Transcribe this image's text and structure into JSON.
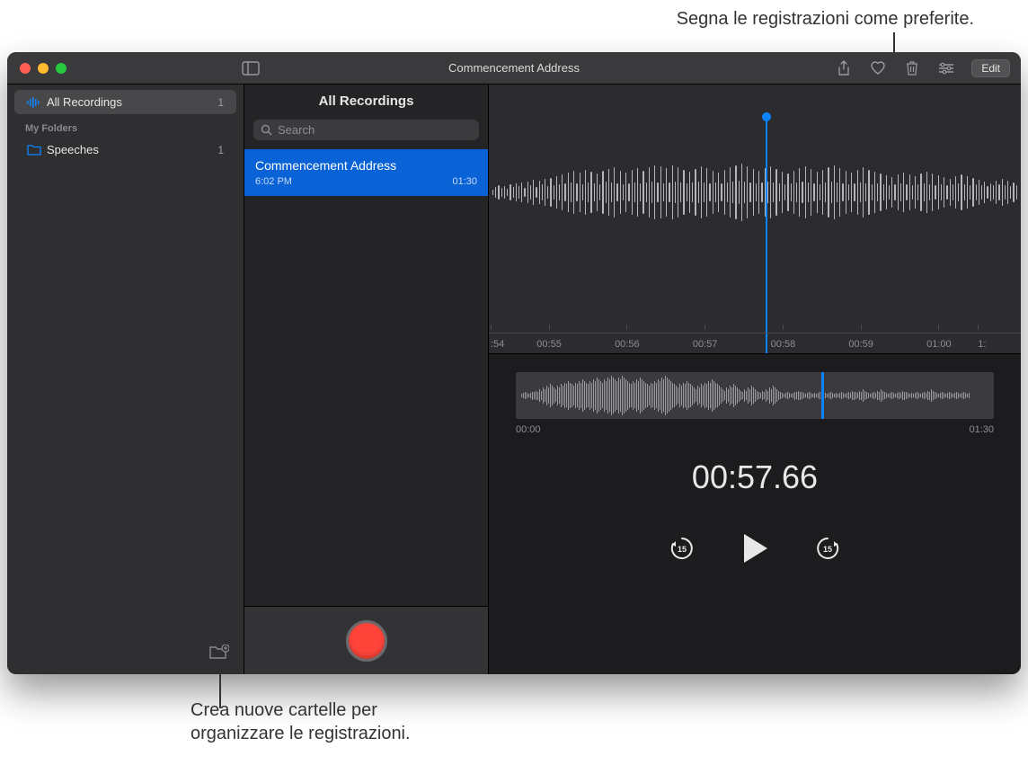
{
  "annotations": {
    "top": "Segna le registrazioni come preferite.",
    "bottom_line1": "Crea nuove cartelle per",
    "bottom_line2": "organizzare le registrazioni."
  },
  "window": {
    "title": "Commencement Address"
  },
  "toolbar": {
    "edit_label": "Edit"
  },
  "sidebar": {
    "all_recordings": {
      "label": "All Recordings",
      "count": "1"
    },
    "section_label": "My Folders",
    "folders": [
      {
        "label": "Speeches",
        "count": "1"
      }
    ]
  },
  "list": {
    "header": "All Recordings",
    "search_placeholder": "Search",
    "items": [
      {
        "name": "Commencement Address",
        "time": "6:02 PM",
        "duration": "01:30"
      }
    ]
  },
  "timeline": {
    "ticks": [
      ":54",
      "00:55",
      "00:56",
      "00:57",
      "00:58",
      "00:59",
      "01:00",
      "1:"
    ]
  },
  "overview": {
    "start": "00:00",
    "end": "01:30"
  },
  "playback": {
    "current_time": "00:57.66"
  },
  "icons": {
    "waveform_bars": [
      6,
      12,
      16,
      10,
      14,
      8,
      18,
      12,
      20,
      14,
      22,
      10,
      24,
      16,
      28,
      12,
      26,
      18,
      30,
      14,
      32,
      16,
      36,
      18,
      40,
      20,
      44,
      22,
      48,
      20,
      44,
      18,
      50,
      22,
      46,
      20,
      42,
      18,
      48,
      24,
      52,
      22,
      56,
      20,
      48,
      18,
      44,
      20,
      50,
      22,
      54,
      20,
      48,
      22,
      56,
      24,
      60,
      22,
      58,
      20,
      54,
      22,
      60,
      24,
      56,
      22,
      50,
      20,
      46,
      22,
      52,
      24,
      58,
      22,
      54,
      20,
      48,
      22,
      44,
      20,
      50,
      22,
      56,
      24,
      60,
      26,
      64,
      24,
      58,
      22,
      52,
      20,
      48,
      22,
      54,
      24,
      58,
      22,
      52,
      20,
      46,
      18,
      42,
      20,
      48,
      22,
      54,
      24,
      58,
      22,
      52,
      20,
      46,
      18,
      50,
      22,
      56,
      24,
      60,
      22,
      54,
      20,
      48,
      18,
      44,
      20,
      50,
      22,
      56,
      20,
      50,
      18,
      46,
      20,
      42,
      18,
      38,
      16,
      34,
      18,
      40,
      20,
      44,
      18,
      40,
      16,
      36,
      18,
      42,
      20,
      46,
      18,
      42,
      16,
      38,
      18,
      34,
      16,
      30,
      18,
      36,
      20,
      40,
      18,
      36,
      16,
      32,
      18,
      28,
      16,
      24,
      14,
      20,
      16,
      26,
      18,
      30,
      16,
      26,
      14,
      22,
      16
    ],
    "overview_bars": [
      2,
      3,
      4,
      3,
      2,
      3,
      5,
      4,
      6,
      5,
      8,
      6,
      10,
      8,
      12,
      10,
      14,
      12,
      10,
      8,
      12,
      10,
      14,
      12,
      16,
      14,
      18,
      16,
      14,
      12,
      16,
      14,
      18,
      16,
      20,
      18,
      16,
      14,
      18,
      16,
      20,
      18,
      22,
      20,
      18,
      16,
      20,
      18,
      22,
      20,
      24,
      22,
      20,
      18,
      22,
      20,
      24,
      22,
      20,
      18,
      16,
      14,
      18,
      16,
      20,
      18,
      22,
      20,
      18,
      16,
      14,
      12,
      16,
      14,
      18,
      16,
      20,
      18,
      22,
      20,
      24,
      22,
      20,
      18,
      16,
      14,
      12,
      10,
      14,
      12,
      16,
      14,
      18,
      16,
      14,
      12,
      10,
      8,
      12,
      10,
      14,
      12,
      16,
      14,
      18,
      16,
      20,
      18,
      16,
      14,
      12,
      10,
      8,
      6,
      10,
      8,
      12,
      10,
      14,
      12,
      10,
      8,
      6,
      4,
      8,
      6,
      10,
      8,
      12,
      10,
      8,
      6,
      4,
      3,
      6,
      4,
      8,
      6,
      10,
      8,
      12,
      10,
      8,
      6,
      4,
      3,
      2,
      3,
      4,
      3,
      2,
      3,
      5,
      4,
      6,
      5,
      4,
      3,
      2,
      3,
      4,
      3,
      2,
      3,
      2,
      3,
      4,
      3,
      2,
      3,
      2,
      3,
      4,
      3,
      2,
      3,
      2,
      3,
      4,
      3,
      2,
      3,
      4,
      3,
      6,
      5,
      4,
      3,
      6,
      5,
      8,
      6,
      4,
      3,
      2,
      3,
      4,
      3,
      6,
      5,
      8,
      6,
      4,
      3,
      2,
      3,
      4,
      3,
      2,
      3,
      4,
      3,
      6,
      5,
      4,
      3,
      2,
      3,
      2,
      3,
      4,
      3,
      2,
      3,
      4,
      3,
      6,
      5,
      8,
      6,
      4,
      3,
      2,
      3,
      4,
      3,
      2,
      3,
      4,
      3,
      2,
      3,
      4,
      3,
      2,
      3,
      4,
      3,
      2,
      3
    ]
  }
}
